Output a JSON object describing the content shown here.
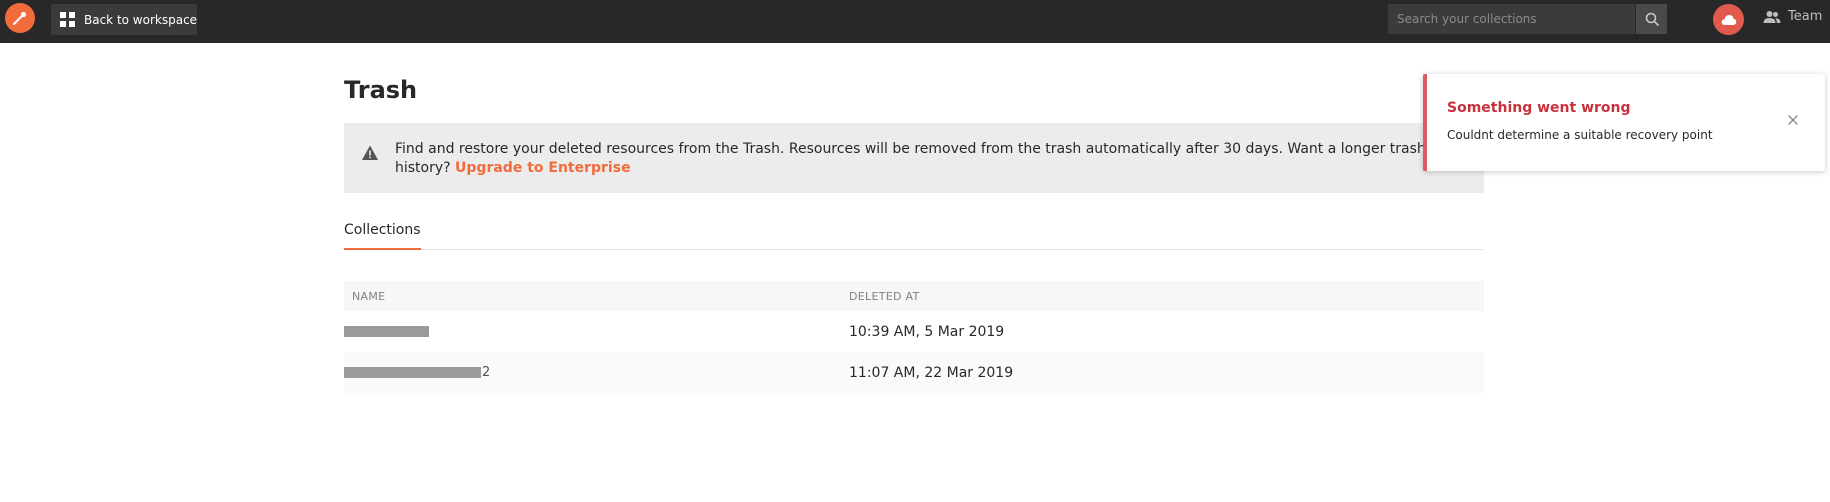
{
  "header": {
    "back_label": "Back to workspace",
    "search_placeholder": "Search your collections",
    "team_label": "Team"
  },
  "page": {
    "title": "Trash",
    "banner_text": "Find and restore your deleted resources from the Trash. Resources will be removed from the trash automatically after 30 days. Want a longer trash history?",
    "banner_link": "Upgrade to Enterprise"
  },
  "tabs": [
    {
      "label": "Collections",
      "active": true
    }
  ],
  "table": {
    "columns": [
      "NAME",
      "DELETED AT"
    ],
    "rows": [
      {
        "name_visible_suffix": "",
        "deleted_at": "10:39 AM, 5 Mar 2019"
      },
      {
        "name_visible_suffix": "2",
        "deleted_at": "11:07 AM, 22 Mar 2019"
      }
    ]
  },
  "toast": {
    "title": "Something went wrong",
    "message": "Couldnt determine a suitable recovery point"
  },
  "colors": {
    "topbar": "#282828",
    "accent": "#f26b3a",
    "error": "#c7323d",
    "sync": "#e05a4e"
  },
  "icons": [
    "logo-icon",
    "grid-icon",
    "search-icon",
    "cloud-icon",
    "team-icon",
    "warning-icon",
    "close-icon"
  ]
}
